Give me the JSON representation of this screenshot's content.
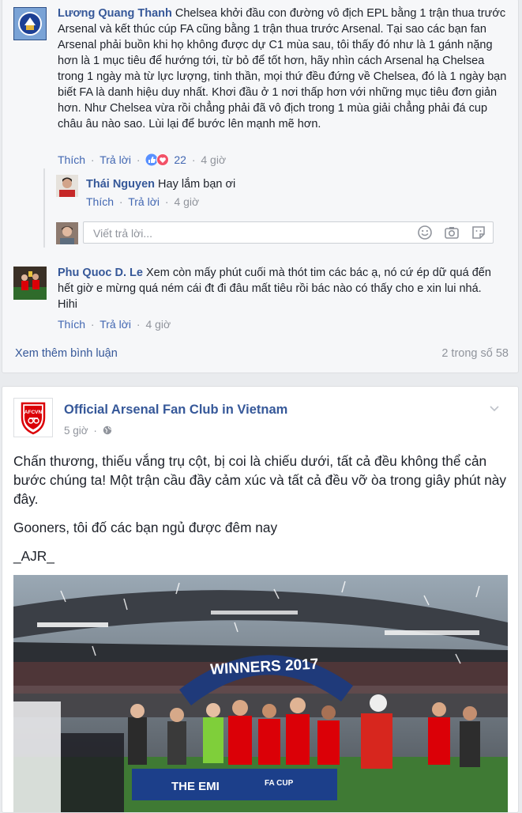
{
  "comments": [
    {
      "name": "Lương Quang Thanh",
      "text": "Chelsea khởi đầu con đường vô địch EPL bằng 1 trận thua trước Arsenal và kết thúc cúp FA cũng bằng 1 trận thua trước Arsenal. Tại sao các bạn fan Arsenal phải buồn khi họ không được dự C1 mùa sau, tôi thấy đó như là 1 gánh nặng hơn là 1 mục tiêu để hướng tới, từ bỏ để tốt hơn, hãy nhìn cách Arsenal hạ Chelsea trong 1 ngày mà từ lực lượng, tinh thần, mọi thứ đều đứng về Chelsea, đó là 1 ngày bạn biết FA là danh hiệu duy nhất. Khơi đầu ở 1 nơi thấp hơn với những mục tiêu đơn giản hơn. Như Chelsea vừa rồi chẳng phải đã vô địch trong 1 mùa giải chẳng phải đá cup châu âu nào sao. Lùi lại để bước lên mạnh mẽ hơn.",
      "like": "Thích",
      "reply": "Trả lời",
      "reactions": "22",
      "time": "4 giờ"
    },
    {
      "name": "Phu Quoc D. Le",
      "text": "Xem còn mấy phút cuối mà thót tim các bác ạ, nó cứ ép dữ quá đến hết giờ e mừng quá ném cái đt đi đâu mất tiêu rồi bác nào có thấy cho e xin lui nhá. Hihi",
      "like": "Thích",
      "reply": "Trả lời",
      "time": "4 giờ"
    }
  ],
  "reply": {
    "name": "Thái Nguyen",
    "text": "Hay lắm bạn ơi",
    "like": "Thích",
    "reply": "Trả lời",
    "time": "4 giờ"
  },
  "reply_box": {
    "placeholder": "Viết trả lời..."
  },
  "footer": {
    "more": "Xem thêm bình luận",
    "count": "2 trong số 58"
  },
  "post": {
    "page_name": "Official Arsenal Fan Club in Vietnam",
    "time": "5 giờ",
    "logo_text": "AFCVN",
    "paragraphs": [
      "Chấn thương, thiếu vắng trụ cột, bị coi là chiếu dưới, tất cả đều không thể cản bước chúng ta! Một trận cầu đầy cảm xúc và tất cả đều vỡ òa trong giây phút này đây.",
      "Gooners, tôi đố các bạn ngủ được đêm nay",
      "_AJR_"
    ],
    "photo": {
      "banner": "WINNERS 2017",
      "board_left": "THE EMI",
      "board_right": "FA CUP"
    }
  },
  "colors": {
    "link": "#365899",
    "action": "#4267b2",
    "meta": "#90949c",
    "arsenal_red": "#db0007"
  }
}
